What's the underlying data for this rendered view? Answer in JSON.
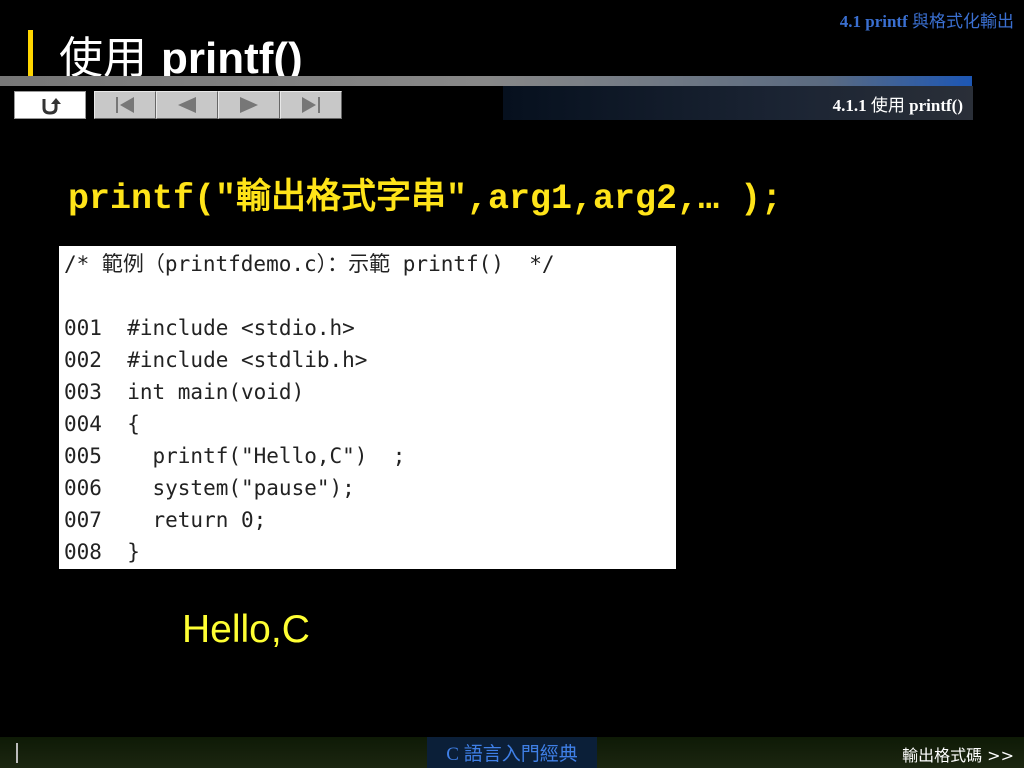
{
  "header": {
    "breadcrumb_en": "4.1  printf",
    "breadcrumb_cn": " 與格式化輸出",
    "title_cn": "使用 ",
    "title_en": "printf()"
  },
  "nav": {
    "home_icon": "return-home-icon",
    "buttons": [
      "first-page-icon",
      "previous-page-icon",
      "next-page-icon",
      "last-page-icon"
    ]
  },
  "section": {
    "label_num": "4.1.1 ",
    "label_cn": "使用 ",
    "label_en": "printf()"
  },
  "syntax": "printf(\"輸出格式字串\",arg1,arg2,… );",
  "code": {
    "header": "/* 範例（printfdemo.c）：示範 printf()  */",
    "lines": [
      "001  #include <stdio.h>",
      "002  #include <stdlib.h>",
      "003  int main(void)",
      "004  {",
      "005    printf(\"Hello,C\")  ;",
      "006    system(\"pause\");",
      "007    return 0;",
      "008  }"
    ]
  },
  "output": "Hello,C",
  "footer": {
    "book_title": "C 語言入門經典",
    "next_link": "輸出格式碼 >>"
  },
  "colors": {
    "background": "#000000",
    "accent_yellow": "#ffe419",
    "accent_blue": "#3a6fd0"
  }
}
